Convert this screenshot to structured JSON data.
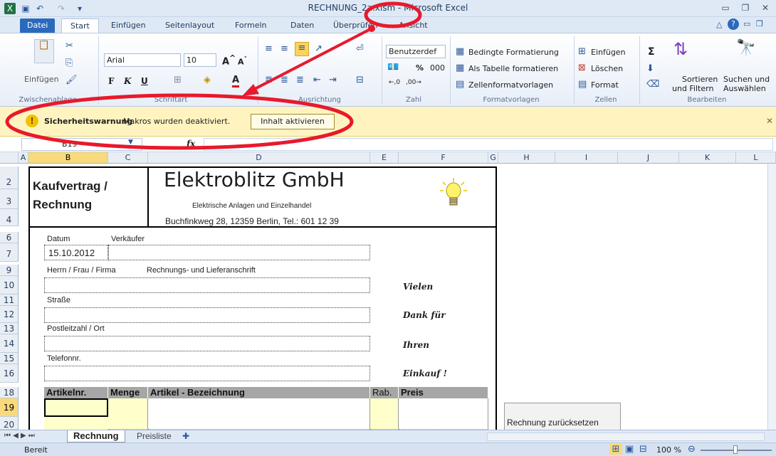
{
  "window": {
    "title": "RECHNUNG_2a.xlsm - Microsoft Excel"
  },
  "tabs": [
    "Datei",
    "Start",
    "Einfügen",
    "Seitenlayout",
    "Formeln",
    "Daten",
    "Überprüfen",
    "Ansicht"
  ],
  "ribbon": {
    "clipboard": {
      "paste": "Einfügen",
      "label": "Zwischenablage"
    },
    "font": {
      "name": "Arial",
      "size": "10",
      "bold": "F",
      "italic": "K",
      "underline": "U",
      "label": "Schriftart"
    },
    "alignment": {
      "label": "Ausrichtung"
    },
    "number": {
      "format": "Benutzerdef",
      "percent": "%",
      "thousands": "000",
      "label": "Zahl"
    },
    "styles": {
      "cond": "Bedingte Formatierung",
      "table": "Als Tabelle formatieren",
      "cellstyles": "Zellenformatvorlagen",
      "label": "Formatvorlagen"
    },
    "cells": {
      "insert": "Einfügen",
      "delete": "Löschen",
      "format": "Format",
      "label": "Zellen"
    },
    "editing": {
      "sum": "Σ",
      "sort1": "Sortieren",
      "sort2": "und Filtern",
      "find1": "Suchen und",
      "find2": "Auswählen",
      "label": "Bearbeiten"
    }
  },
  "security": {
    "label": "Sicherheitswarnung",
    "message": "Makros wurden deaktiviert.",
    "button": "Inhalt aktivieren"
  },
  "formula": {
    "namebox": "B19",
    "fx": "fx"
  },
  "columns": [
    "A",
    "B",
    "C",
    "D",
    "E",
    "F",
    "G",
    "H",
    "I",
    "J",
    "K",
    "L"
  ],
  "rows": [
    "2",
    "3",
    "4",
    "6",
    "7",
    "9",
    "10",
    "11",
    "12",
    "13",
    "14",
    "15",
    "16",
    "18",
    "19",
    "20"
  ],
  "sheet": {
    "doc_title1": "Kaufvertrag /",
    "doc_title2": "Rechnung",
    "company": "Elektroblitz GmbH",
    "tagline": "Elektrische Anlagen und Einzelhandel",
    "address": "Buchfinkweg 28, 12359 Berlin, Tel.: 601 12 39",
    "datum_label": "Datum",
    "verkaeufer_label": "Verkäufer",
    "datum_value": "15.10.2012",
    "herr_label": "Herrn / Frau / Firma",
    "rechnung_label": "Rechnungs- und Lieferanschrift",
    "strasse_label": "Straße",
    "plz_label": "Postleitzahl / Ort",
    "tel_label": "Telefonnr.",
    "thanks1": "Vielen",
    "thanks2": "Dank für",
    "thanks3": "Ihren",
    "thanks4": "Einkauf !",
    "table_headers": [
      "Artikelnr.",
      "Menge",
      "Artikel - Bezeichnung",
      "Rab.",
      "Preis"
    ],
    "reset_button": "Rechnung zurücksetzen"
  },
  "sheet_tabs": [
    "Rechnung",
    "Preisliste"
  ],
  "status": {
    "ready": "Bereit",
    "zoom": "100 %"
  },
  "colors": {
    "highlight": "#e8192c",
    "warn_bar": "#fff4c0",
    "selected_header": "#f8d97b",
    "yellow_cell": "#ffffcc"
  }
}
